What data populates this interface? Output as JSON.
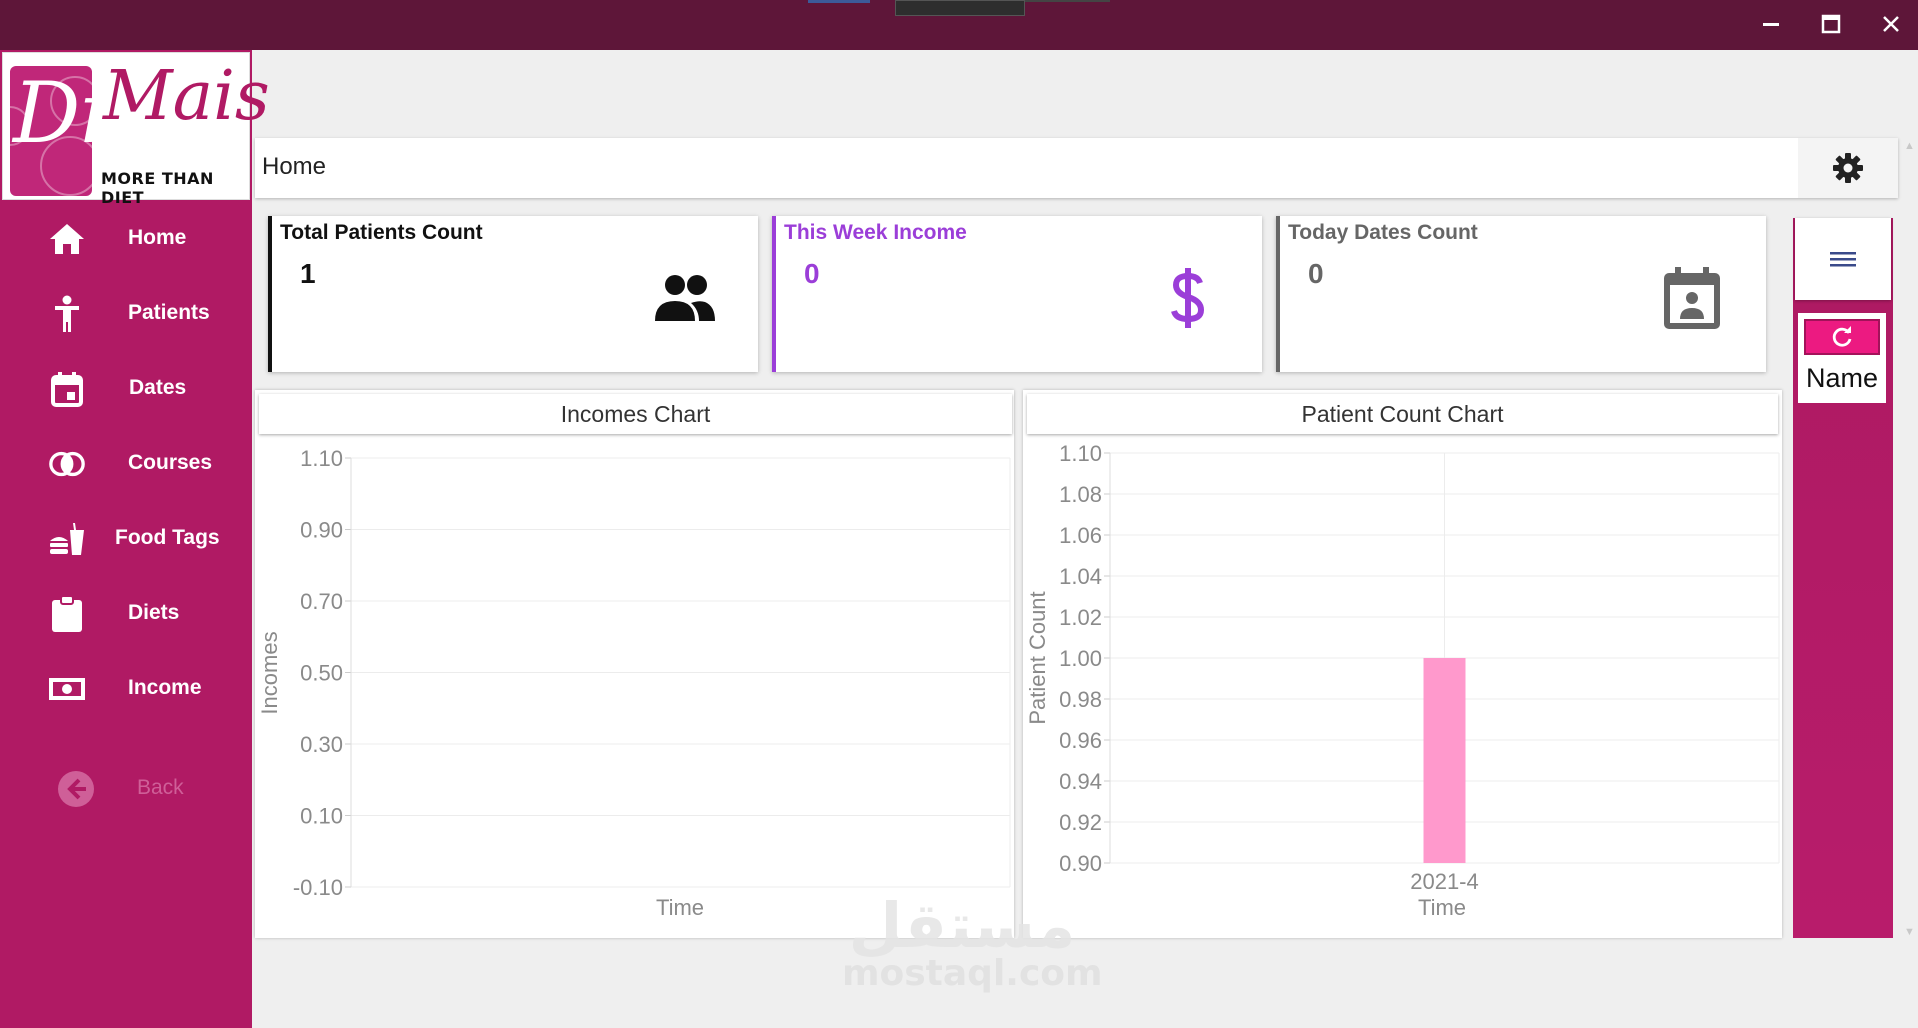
{
  "window": {
    "controls": [
      "minimize-icon",
      "maximize-icon",
      "close-icon"
    ],
    "titlebar_color": "#5e1639"
  },
  "logo": {
    "mark_text": "Dr.",
    "name_text": "Mais",
    "tagline": "MORE THAN DIET"
  },
  "sidebar": {
    "color": "#b01a64",
    "items": [
      {
        "label": "Home",
        "icon": "home-icon"
      },
      {
        "label": "Patients",
        "icon": "person-icon"
      },
      {
        "label": "Dates",
        "icon": "calendar-icon"
      },
      {
        "label": "Courses",
        "icon": "rings-icon"
      },
      {
        "label": "Food Tags",
        "icon": "fastfood-icon"
      },
      {
        "label": "Diets",
        "icon": "clipboard-icon"
      },
      {
        "label": "Income",
        "icon": "money-icon"
      }
    ],
    "back_label": "Back"
  },
  "header": {
    "breadcrumb": "Home",
    "settings_icon": "gear-icon"
  },
  "cards": [
    {
      "title": "Total Patients Count",
      "value": "1",
      "icon": "people-icon",
      "color": "#111111"
    },
    {
      "title": "This Week Income",
      "value": "0",
      "icon": "dollar-icon",
      "color": "#9b3ed8"
    },
    {
      "title": "Today Dates Count",
      "value": "0",
      "icon": "calendar-account-icon",
      "color": "#666666"
    }
  ],
  "side_panel": {
    "menu_icon": "hamburger-icon",
    "refresh_icon": "refresh-icon",
    "name_label": "Name",
    "accent": "#ec1a81"
  },
  "chart_data": [
    {
      "type": "line",
      "title": "Incomes Chart",
      "xlabel": "Time",
      "ylabel": "Incomes",
      "ylim": [
        -0.1,
        1.1
      ],
      "yticks": [
        "1.10",
        "0.90",
        "0.70",
        "0.50",
        "0.30",
        "0.10",
        "-0.10"
      ],
      "categories": [],
      "series": [],
      "grid": true
    },
    {
      "type": "bar",
      "title": "Patient Count Chart",
      "xlabel": "Time",
      "ylabel": "Patient Count",
      "ylim": [
        0.9,
        1.1
      ],
      "yticks": [
        "1.10",
        "1.08",
        "1.06",
        "1.04",
        "1.02",
        "1.00",
        "0.98",
        "0.96",
        "0.94",
        "0.92",
        "0.90"
      ],
      "categories": [
        "2021-4"
      ],
      "values": [
        1
      ],
      "bar_color": "#ff99cc",
      "grid": true
    }
  ],
  "watermark": {
    "arabic": "مستقل",
    "latin": "mostaql.com"
  }
}
